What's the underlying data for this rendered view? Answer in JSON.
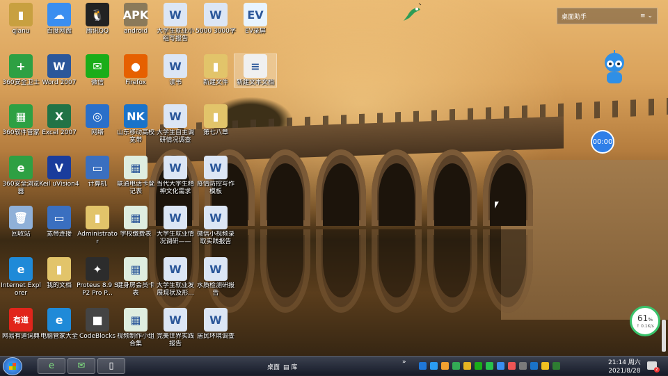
{
  "desktop": {
    "icons": [
      {
        "label": "qianu",
        "color": "#c8a040",
        "glyph": "▮"
      },
      {
        "label": "百度网盘",
        "color": "#3a8ef0",
        "glyph": "☁"
      },
      {
        "label": "腾讯QQ",
        "color": "#222222",
        "glyph": "🐧"
      },
      {
        "label": "android",
        "color": "#8b7a5a",
        "glyph": "APK"
      },
      {
        "label": "大学生就业小组写报告",
        "color": "#dce6f5",
        "glyph": "W"
      },
      {
        "label": "5000 3000字",
        "color": "#dce6f5",
        "glyph": "W"
      },
      {
        "label": "EV录屏",
        "color": "#e8f4ff",
        "glyph": "EV"
      },
      {
        "label": "360安全卫士",
        "color": "#2ea043",
        "glyph": "+"
      },
      {
        "label": "Word 2007",
        "color": "#2b579a",
        "glyph": "W"
      },
      {
        "label": "微信",
        "color": "#1aad19",
        "glyph": "✉"
      },
      {
        "label": "Firefox",
        "color": "#e66000",
        "glyph": "●"
      },
      {
        "label": "读书",
        "color": "#dce6f5",
        "glyph": "W"
      },
      {
        "label": "新建文件",
        "color": "#e2c46a",
        "glyph": "▮"
      },
      {
        "label": "新建文本文档",
        "color": "#f0f0f0",
        "glyph": "≡"
      },
      {
        "label": "360软件管家",
        "color": "#2ea043",
        "glyph": "▦"
      },
      {
        "label": "Excel 2007",
        "color": "#217346",
        "glyph": "X"
      },
      {
        "label": "网络",
        "color": "#2a6fc9",
        "glyph": "◎"
      },
      {
        "label": "山东移动高校宽带",
        "color": "#1a73c9",
        "glyph": "NK"
      },
      {
        "label": "大学生自主调研情况调查",
        "color": "#dce6f5",
        "glyph": "W"
      },
      {
        "label": "第七八章",
        "color": "#e2c46a",
        "glyph": "▮"
      },
      {
        "label": "360安全浏览器",
        "color": "#2ea043",
        "glyph": "e"
      },
      {
        "label": "Keil uVision4",
        "color": "#1a3c9c",
        "glyph": "V"
      },
      {
        "label": "计算机",
        "color": "#3a6fc0",
        "glyph": "▭"
      },
      {
        "label": "联通电话卡登记表",
        "color": "#dfeee0",
        "glyph": "▦"
      },
      {
        "label": "当代大学生精神文化需求",
        "color": "#dce6f5",
        "glyph": "W"
      },
      {
        "label": "疫情防控写作模板",
        "color": "#dce6f5",
        "glyph": "W"
      },
      {
        "label": "回收站",
        "color": "#8fb0d8",
        "glyph": "🗑"
      },
      {
        "label": "宽带连接",
        "color": "#3a6fc0",
        "glyph": "▭"
      },
      {
        "label": "Administrator",
        "color": "#e2c46a",
        "glyph": "▮"
      },
      {
        "label": "学校缴费表",
        "color": "#dfeee0",
        "glyph": "▦"
      },
      {
        "label": "大学生就业情况调研——",
        "color": "#dce6f5",
        "glyph": "W"
      },
      {
        "label": "微信小视频录取实践报告",
        "color": "#dce6f5",
        "glyph": "W"
      },
      {
        "label": "Internet Explorer",
        "color": "#1f8ad8",
        "glyph": "e"
      },
      {
        "label": "我的文档",
        "color": "#e2c46a",
        "glyph": "▮"
      },
      {
        "label": "Proteus 8.9 SP2 Pro P...",
        "color": "#2c2c2c",
        "glyph": "✦"
      },
      {
        "label": "健身房会员卡表",
        "color": "#dfeee0",
        "glyph": "▦"
      },
      {
        "label": "大学生就业发展现状及形...",
        "color": "#dce6f5",
        "glyph": "W"
      },
      {
        "label": "水质检测研报告",
        "color": "#dce6f5",
        "glyph": "W"
      },
      {
        "label": "有道",
        "color": "#e1251b",
        "glyph": "有道"
      },
      {
        "label": "网易有道词典",
        "color": "#e1251b",
        "glyph": ""
      },
      {
        "label": "电脑管家大全",
        "color": "#1f8ad8",
        "glyph": "e"
      },
      {
        "label": "CodeBlocks",
        "color": "#444444",
        "glyph": "■"
      },
      {
        "label": "视频制作小组合集",
        "color": "#dfeee0",
        "glyph": "▦"
      },
      {
        "label": "完美世界实践报告",
        "color": "#dce6f5",
        "glyph": "W"
      },
      {
        "label": "居民环境调查",
        "color": "#dce6f5",
        "glyph": "W"
      }
    ]
  },
  "assistant": {
    "title": "桌面助手",
    "menu_icon": "menu-icon",
    "chevron": "chevron-down-icon"
  },
  "clock_bubble": {
    "text": "00:00"
  },
  "net_meter": {
    "percent": "61",
    "unit": "%",
    "speed": "↑ 0.1K/s"
  },
  "taskbar": {
    "desktop_label": "桌面",
    "library_label": "库",
    "expand_glyph": "»",
    "time": "21:14 周六",
    "date": "2021/8/28",
    "notification_count": "2"
  },
  "colors": {
    "tray": [
      "#1f77d8",
      "#2a9df4",
      "#f0a030",
      "#33aa55",
      "#e6b422",
      "#1aad19",
      "#27c24c",
      "#3a8ef0",
      "#e55",
      "#7a7a7a",
      "#1a73c9",
      "#f0c020",
      "#2e7d32"
    ]
  }
}
